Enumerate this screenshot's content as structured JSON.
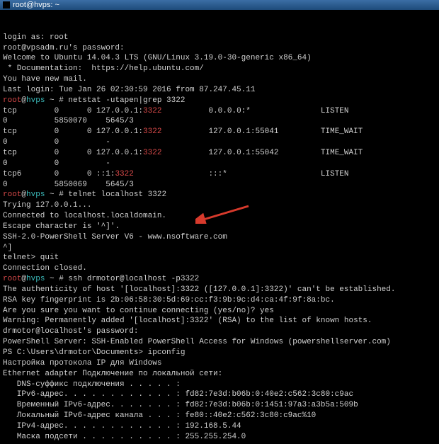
{
  "title": "root@hvps: ~",
  "lines": [
    {
      "segments": [
        {
          "text": "login as: root",
          "cls": "white"
        }
      ]
    },
    {
      "segments": [
        {
          "text": "root@vpsadm.ru's password:",
          "cls": "white"
        }
      ]
    },
    {
      "segments": [
        {
          "text": "Welcome to Ubuntu 14.04.3 LTS (GNU/Linux 3.19.0-30-generic x86_64)",
          "cls": "white"
        }
      ]
    },
    {
      "segments": [
        {
          "text": "",
          "cls": "white"
        }
      ]
    },
    {
      "segments": [
        {
          "text": " * Documentation:  https://help.ubuntu.com/",
          "cls": "white"
        }
      ]
    },
    {
      "segments": [
        {
          "text": "You have new mail.",
          "cls": "white"
        }
      ]
    },
    {
      "segments": [
        {
          "text": "Last login: Tue Jan 26 02:30:59 2016 from 87.247.45.11",
          "cls": "white"
        }
      ]
    },
    {
      "segments": [
        {
          "text": "root",
          "cls": "red"
        },
        {
          "text": "@",
          "cls": "white"
        },
        {
          "text": "hvps",
          "cls": "cyan"
        },
        {
          "text": " ~ #",
          "cls": "white"
        },
        {
          "text": " netstat -utapen|grep 3322",
          "cls": "white"
        }
      ]
    },
    {
      "segments": [
        {
          "text": "tcp        0      0 127.0.0.1:",
          "cls": "white"
        },
        {
          "text": "3322",
          "cls": "red"
        },
        {
          "text": "          0.0.0.0:*               LISTEN",
          "cls": "white"
        }
      ]
    },
    {
      "segments": [
        {
          "text": "0          5850070    5645/3",
          "cls": "white"
        }
      ]
    },
    {
      "segments": [
        {
          "text": "tcp        0      0 127.0.0.1:",
          "cls": "white"
        },
        {
          "text": "3322",
          "cls": "red"
        },
        {
          "text": "          127.0.0.1:55041         TIME_WAIT",
          "cls": "white"
        }
      ]
    },
    {
      "segments": [
        {
          "text": "0          0          -",
          "cls": "white"
        }
      ]
    },
    {
      "segments": [
        {
          "text": "tcp        0      0 127.0.0.1:",
          "cls": "white"
        },
        {
          "text": "3322",
          "cls": "red"
        },
        {
          "text": "          127.0.0.1:55042         TIME_WAIT",
          "cls": "white"
        }
      ]
    },
    {
      "segments": [
        {
          "text": "0          0          -",
          "cls": "white"
        }
      ]
    },
    {
      "segments": [
        {
          "text": "tcp6       0      0 ::1:",
          "cls": "white"
        },
        {
          "text": "3322",
          "cls": "red"
        },
        {
          "text": "                :::*                    LISTEN",
          "cls": "white"
        }
      ]
    },
    {
      "segments": [
        {
          "text": "0          5850069    5645/3",
          "cls": "white"
        }
      ]
    },
    {
      "segments": [
        {
          "text": "root",
          "cls": "red"
        },
        {
          "text": "@",
          "cls": "white"
        },
        {
          "text": "hvps",
          "cls": "cyan"
        },
        {
          "text": " ~ #",
          "cls": "white"
        },
        {
          "text": " telnet localhost 3322",
          "cls": "white"
        }
      ]
    },
    {
      "segments": [
        {
          "text": "Trying 127.0.0.1...",
          "cls": "white"
        }
      ]
    },
    {
      "segments": [
        {
          "text": "Connected to localhost.localdomain.",
          "cls": "white"
        }
      ]
    },
    {
      "segments": [
        {
          "text": "Escape character is '^]'.",
          "cls": "white"
        }
      ]
    },
    {
      "segments": [
        {
          "text": "SSH-2.0-PowerShell Server V6 - www.nsoftware.com",
          "cls": "white"
        }
      ]
    },
    {
      "segments": [
        {
          "text": "^]",
          "cls": "white"
        }
      ]
    },
    {
      "segments": [
        {
          "text": "telnet> quit",
          "cls": "white"
        }
      ]
    },
    {
      "segments": [
        {
          "text": "Connection closed.",
          "cls": "white"
        }
      ]
    },
    {
      "segments": [
        {
          "text": "root",
          "cls": "red"
        },
        {
          "text": "@",
          "cls": "white"
        },
        {
          "text": "hvps",
          "cls": "cyan"
        },
        {
          "text": " ~ #",
          "cls": "white"
        },
        {
          "text": " ssh drmotor@localhost -p3322",
          "cls": "white"
        }
      ]
    },
    {
      "segments": [
        {
          "text": "The authenticity of host '[localhost]:3322 ([127.0.0.1]:3322)' can't be established.",
          "cls": "white"
        }
      ]
    },
    {
      "segments": [
        {
          "text": "RSA key fingerprint is 2b:06:58:30:5d:69:cc:f3:9b:9c:d4:ca:4f:9f:8a:bc.",
          "cls": "white"
        }
      ]
    },
    {
      "segments": [
        {
          "text": "Are you sure you want to continue connecting (yes/no)? yes",
          "cls": "white"
        }
      ]
    },
    {
      "segments": [
        {
          "text": "Warning: Permanently added '[localhost]:3322' (RSA) to the list of known hosts.",
          "cls": "white"
        }
      ]
    },
    {
      "segments": [
        {
          "text": "drmotor@localhost's password:",
          "cls": "white"
        }
      ]
    },
    {
      "segments": [
        {
          "text": "PowerShell Server: SSH-Enabled PowerShell Access for Windows (powershellserver.com)",
          "cls": "white"
        }
      ]
    },
    {
      "segments": [
        {
          "text": "",
          "cls": "white"
        }
      ]
    },
    {
      "segments": [
        {
          "text": "PS C:\\Users\\drmotor\\Documents> ipconfig",
          "cls": "white"
        }
      ]
    },
    {
      "segments": [
        {
          "text": "",
          "cls": "white"
        }
      ]
    },
    {
      "segments": [
        {
          "text": "Настройка протокола IP для Windows",
          "cls": "white"
        }
      ]
    },
    {
      "segments": [
        {
          "text": "",
          "cls": "white"
        }
      ]
    },
    {
      "segments": [
        {
          "text": "",
          "cls": "white"
        }
      ]
    },
    {
      "segments": [
        {
          "text": "Ethernet adapter Подключение по локальной сети:",
          "cls": "white"
        }
      ]
    },
    {
      "segments": [
        {
          "text": "",
          "cls": "white"
        }
      ]
    },
    {
      "segments": [
        {
          "text": "   DNS-суффикс подключения . . . . . :",
          "cls": "white"
        }
      ]
    },
    {
      "segments": [
        {
          "text": "   IPv6-адрес. . . . . . . . . . . . : fd82:7e3d:b06b:0:40e2:c562:3c80:c9ac",
          "cls": "white"
        }
      ]
    },
    {
      "segments": [
        {
          "text": "   Временный IPv6-адрес. . . . . . . : fd82:7e3d:b06b:0:1451:97a3:a3b5a:509b",
          "cls": "white"
        }
      ]
    },
    {
      "segments": [
        {
          "text": "   Локальный IPv6-адрес канала . . . : fe80::40e2:c562:3c80:c9ac%10",
          "cls": "white"
        }
      ]
    },
    {
      "segments": [
        {
          "text": "   IPv4-адрес. . . . . . . . . . . . : 192.168.5.44",
          "cls": "white"
        }
      ]
    },
    {
      "segments": [
        {
          "text": "   Маска подсети . . . . . . . . . . : 255.255.254.0",
          "cls": "white"
        }
      ]
    }
  ]
}
